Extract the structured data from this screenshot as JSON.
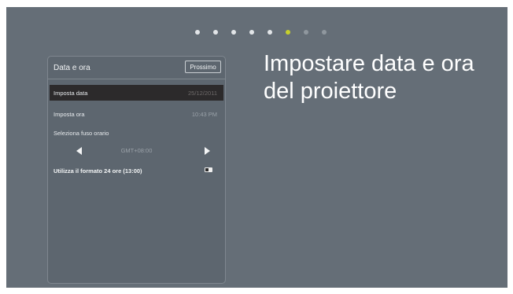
{
  "pager": {
    "total": 8,
    "active_index": 5
  },
  "panel": {
    "title": "Data e ora",
    "next_label": "Prossimo",
    "rows": [
      {
        "label": "Imposta data",
        "value": "25/12/2011"
      },
      {
        "label": "Imposta ora",
        "value": "10:43 PM"
      }
    ],
    "timezone_label": "Seleziona fuso orario",
    "timezone_value": "GMT+08:00",
    "format_label": "Utilizza il formato 24 ore (13:00)"
  },
  "heading": "Impostare data e ora del proiettore",
  "colors": {
    "screen_bg": "#656e77",
    "panel_bg": "#5d666f",
    "selected_row": "#2c2a2b",
    "active_dot": "#c6d02c"
  }
}
